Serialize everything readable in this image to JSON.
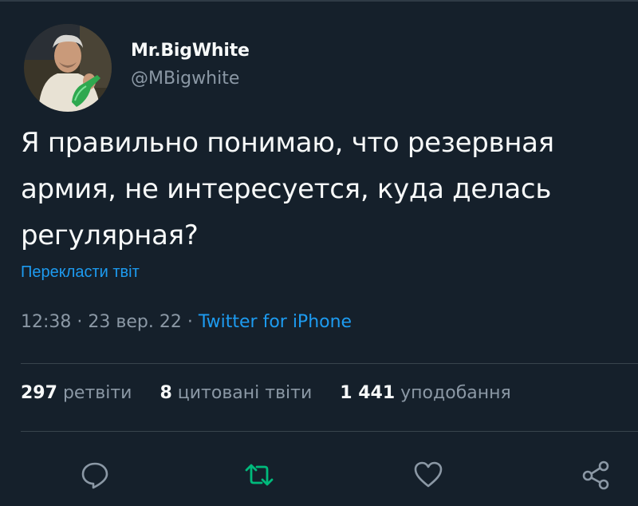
{
  "author": {
    "display_name": "Mr.BigWhite",
    "handle": "@MBigwhite"
  },
  "tweet": {
    "lines": [
      "Я правильно понимаю, что резервная",
      "армия, не интересуется, куда делась",
      "регулярная?"
    ],
    "translate_label": "Перекласти твіт",
    "time": "12:38",
    "separator": "·",
    "date": "23 вер. 22",
    "source": "Twitter for iPhone"
  },
  "stats": {
    "retweets_count": "297",
    "retweets_label": "ретвіти",
    "quotes_count": "8",
    "quotes_label": "цитовані твіти",
    "likes_count": "1 441",
    "likes_label": "уподобання"
  },
  "actions": {
    "reply_icon": "reply-icon",
    "retweet_icon": "retweet-icon",
    "like_icon": "heart-icon",
    "share_icon": "share-icon"
  },
  "colors": {
    "background": "#15202b",
    "text": "#f7f9f9",
    "secondary": "#8b98a5",
    "accent": "#1d9bf0",
    "retweet": "#00ba7c",
    "divider": "#38444d"
  }
}
